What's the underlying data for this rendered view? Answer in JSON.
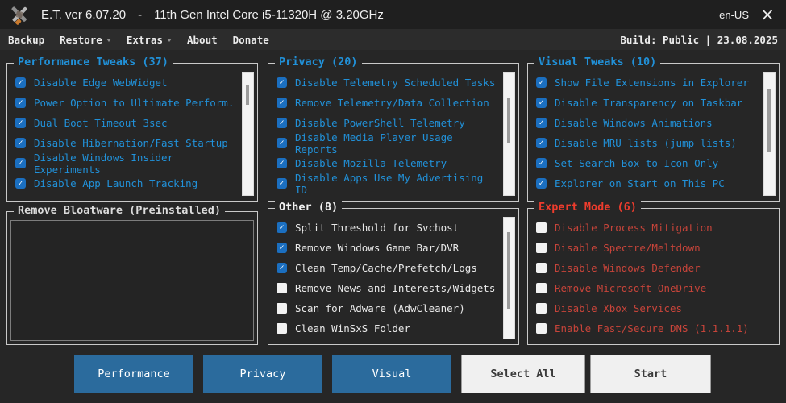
{
  "window": {
    "title_app": "E.T. ver 6.07.20",
    "title_sep": "-",
    "title_cpu": "11th Gen Intel Core i5-11320H @ 3.20GHz",
    "locale": "en-US",
    "close_glyph": "×"
  },
  "menubar": {
    "items": [
      {
        "label": "Backup",
        "dropdown": false
      },
      {
        "label": "Restore",
        "dropdown": true
      },
      {
        "label": "Extras",
        "dropdown": true
      },
      {
        "label": "About",
        "dropdown": false
      },
      {
        "label": "Donate",
        "dropdown": false
      }
    ],
    "build_info": "Build: Public | 23.08.2025"
  },
  "groups": {
    "performance": {
      "title": "Performance Tweaks (37)",
      "items": [
        {
          "label": "Disable Edge WebWidget",
          "checked": true
        },
        {
          "label": "Power Option to Ultimate Perform.",
          "checked": true
        },
        {
          "label": "Dual Boot Timeout 3sec",
          "checked": true
        },
        {
          "label": "Disable Hibernation/Fast Startup",
          "checked": true
        },
        {
          "label": "Disable Windows Insider Experiments",
          "checked": true
        },
        {
          "label": "Disable App Launch Tracking",
          "checked": true
        }
      ]
    },
    "privacy": {
      "title": "Privacy (20)",
      "items": [
        {
          "label": "Disable Telemetry Scheduled Tasks",
          "checked": true
        },
        {
          "label": "Remove Telemetry/Data Collection",
          "checked": true
        },
        {
          "label": "Disable PowerShell Telemetry",
          "checked": true
        },
        {
          "label": "Disable Media Player Usage Reports",
          "checked": true
        },
        {
          "label": "Disable Mozilla Telemetry",
          "checked": true
        },
        {
          "label": "Disable Apps Use My Advertising ID",
          "checked": true
        }
      ]
    },
    "visual": {
      "title": "Visual Tweaks (10)",
      "items": [
        {
          "label": "Show File Extensions in Explorer",
          "checked": true
        },
        {
          "label": "Disable Transparency on Taskbar",
          "checked": true
        },
        {
          "label": "Disable Windows Animations",
          "checked": true
        },
        {
          "label": "Disable MRU lists (jump lists)",
          "checked": true
        },
        {
          "label": "Set Search Box to Icon Only",
          "checked": true
        },
        {
          "label": "Explorer on Start on This PC",
          "checked": true
        }
      ]
    },
    "bloatware": {
      "title": "Remove Bloatware (Preinstalled)",
      "items": []
    },
    "other": {
      "title": "Other (8)",
      "items": [
        {
          "label": "Split Threshold for Svchost",
          "checked": true
        },
        {
          "label": "Remove Windows Game Bar/DVR",
          "checked": true
        },
        {
          "label": "Clean Temp/Cache/Prefetch/Logs",
          "checked": true
        },
        {
          "label": "Remove News and Interests/Widgets",
          "checked": false
        },
        {
          "label": "Scan for Adware (AdwCleaner)",
          "checked": false
        },
        {
          "label": "Clean WinSxS Folder",
          "checked": false
        }
      ]
    },
    "expert": {
      "title": "Expert Mode (6)",
      "items": [
        {
          "label": "Disable Process Mitigation",
          "checked": false
        },
        {
          "label": "Disable Spectre/Meltdown",
          "checked": false
        },
        {
          "label": "Disable Windows Defender",
          "checked": false
        },
        {
          "label": "Remove Microsoft OneDrive",
          "checked": false
        },
        {
          "label": "Disable Xbox Services",
          "checked": false
        },
        {
          "label": "Enable Fast/Secure DNS (1.1.1.1)",
          "checked": false
        }
      ]
    }
  },
  "buttons": {
    "performance": "Performance",
    "privacy": "Privacy",
    "visual": "Visual",
    "select_all": "Select All",
    "start": "Start"
  },
  "colors": {
    "accent_blue": "#2191d9",
    "expert_red": "#ee3c2d",
    "expert_item_red": "#c7443a",
    "button_blue": "#2b6b9d",
    "checkbox_checked": "#1b6fc0"
  }
}
